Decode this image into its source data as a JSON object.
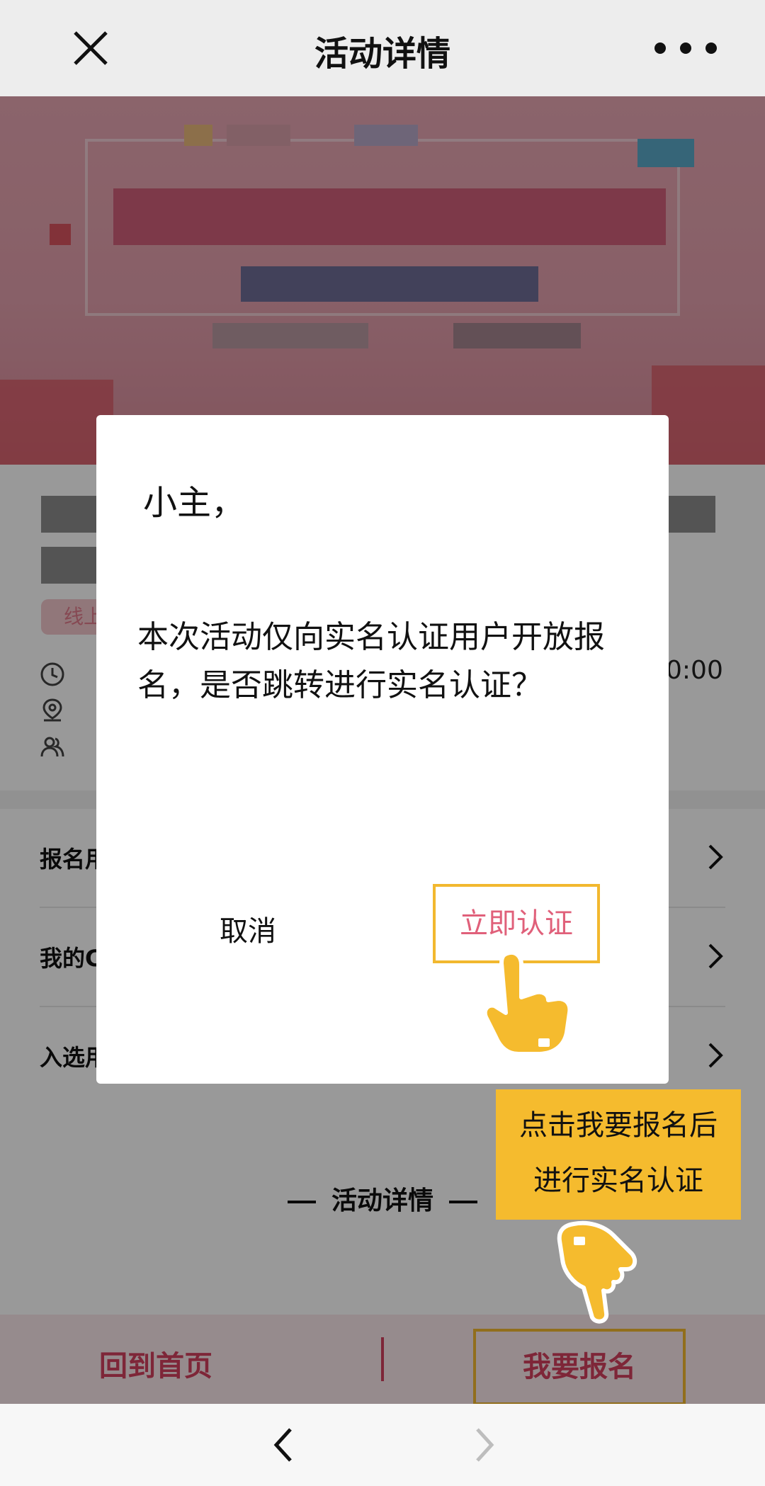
{
  "header": {
    "title": "活动详情",
    "close_icon": "close-icon",
    "more_icon": "more-dots-icon"
  },
  "info": {
    "tag_label": "线上",
    "time_tail": "0:00"
  },
  "menu": [
    {
      "label": "报名用",
      "icon": "chevron-right-icon"
    },
    {
      "label": "我的C",
      "icon": "chevron-right-icon"
    },
    {
      "label": "入选用",
      "icon": "chevron-right-icon"
    }
  ],
  "detail_heading": "活动详情",
  "actionbar": {
    "home_label": "回到首页",
    "signup_label": "我要报名"
  },
  "modal": {
    "greeting": "小主，",
    "message": "本次活动仅向实名认证用户开放报名，是否跳转进行实名认证？",
    "cancel_label": "取消",
    "confirm_label": "立即认证"
  },
  "callout": {
    "line1": "点击我要报名后",
    "line2": "进行实名认证"
  },
  "colors": {
    "accent": "#d2405e",
    "highlight": "#f2b82f",
    "confirm_text": "#e0607a"
  },
  "navbar": {
    "back_icon": "chevron-left-icon",
    "forward_icon": "chevron-right-icon"
  }
}
